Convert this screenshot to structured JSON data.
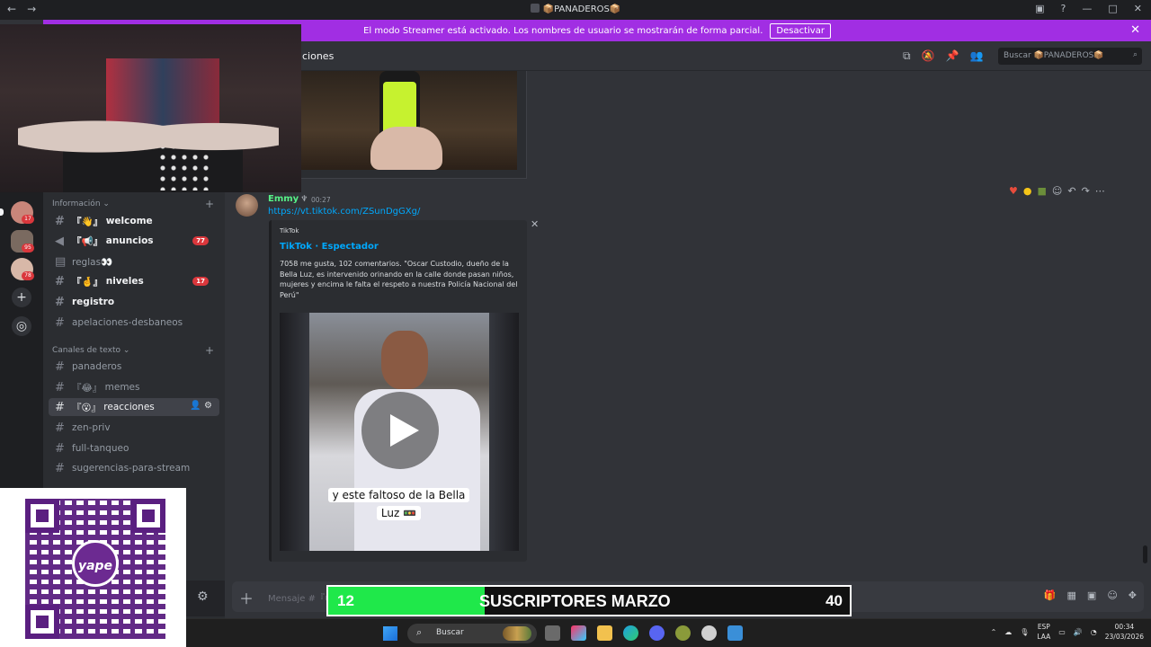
{
  "titlebar": {
    "title": "📦PANADEROS📦"
  },
  "banner": {
    "text": "El modo Streamer está activado. Los nombres de usuario se mostrarán de forma parcial.",
    "button_label": "Desactivar"
  },
  "channel_header": {
    "name": "ciones",
    "search_placeholder": "Buscar 📦PANADEROS📦"
  },
  "servers": [
    {
      "badge": "17"
    },
    {
      "badge": "95"
    },
    {
      "badge": "78"
    }
  ],
  "sidebar": {
    "cat_info": "Información",
    "cat_text": "Canales de texto",
    "items": [
      {
        "label": "welcome",
        "prefix": "『👋』",
        "unread": true
      },
      {
        "label": "anuncios",
        "prefix": "『📢』",
        "unread": true,
        "badge": "77"
      },
      {
        "label": "reglas👀",
        "prefix": "",
        "unread": false
      },
      {
        "label": "niveles",
        "prefix": "『🤞』",
        "unread": true,
        "badge": "17"
      },
      {
        "label": "registro",
        "prefix": "",
        "unread": true
      },
      {
        "label": "apelaciones-desbaneos",
        "prefix": "",
        "unread": false
      },
      {
        "label": "panaderos",
        "prefix": "",
        "unread": false
      },
      {
        "label": "memes",
        "prefix": "『😂』",
        "unread": false
      },
      {
        "label": "reacciones",
        "prefix": "『😮』",
        "unread": false,
        "active": true
      },
      {
        "label": "zen-priv",
        "prefix": "",
        "unread": false
      },
      {
        "label": "full-tanqueo",
        "prefix": "",
        "unread": false
      },
      {
        "label": "sugerencias-para-stream",
        "prefix": "",
        "unread": false
      }
    ]
  },
  "message": {
    "author": "Emmy",
    "time": "00:27",
    "link": "https://vt.tiktok.com/ZSunDgGXg/",
    "embed": {
      "provider": "TikTok",
      "title": "TikTok · Espectador",
      "description": "7058 me gusta, 102 comentarios. \"Oscar Custodio, dueño de la Bella Luz, es intervenido orinando en la calle donde pasan niños, mujeres y encima le falta el respeto a nuestra Policía Nacional del Perú\"",
      "caption_line1": "y este faltoso de la Bella",
      "caption_line2": "Luz 🚥"
    }
  },
  "composer": {
    "placeholder": "Mensaje #『😮』"
  },
  "overlay": {
    "qr_logo": "yape",
    "sub_current": "12",
    "sub_label": "SUSCRIPTORES MARZO",
    "sub_goal": "40",
    "sub_progress": 0.3
  },
  "taskbar": {
    "search_label": "Buscar",
    "lang1": "ESP",
    "lang2": "LAA",
    "time": "00:34",
    "date": "23/03/2026"
  }
}
